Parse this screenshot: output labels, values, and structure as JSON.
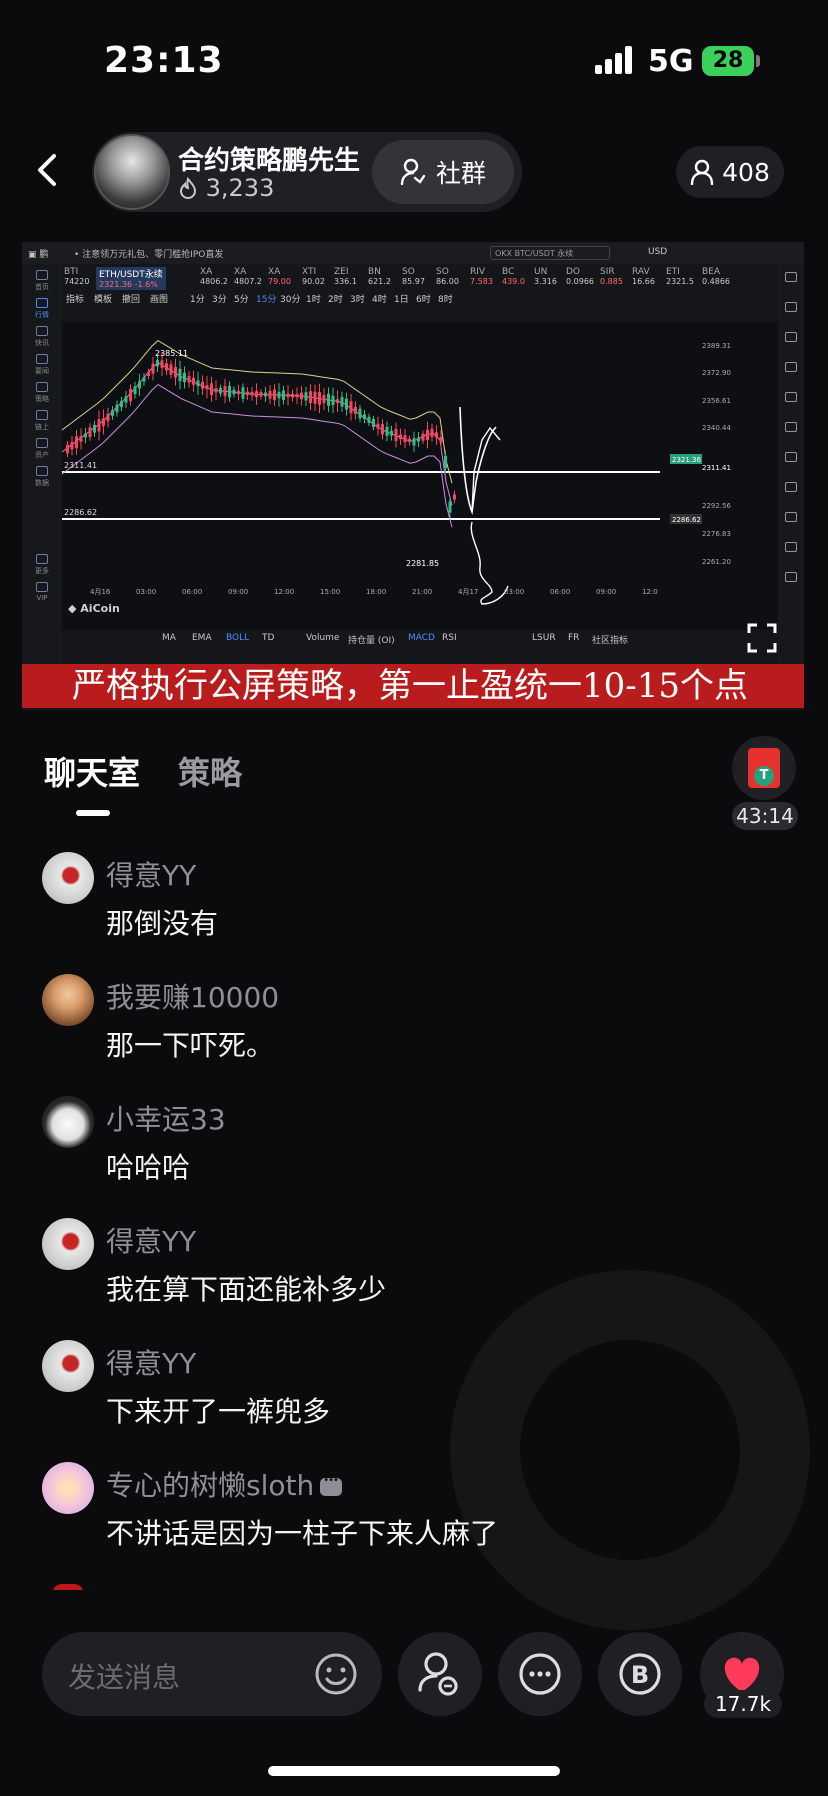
{
  "status": {
    "time": "23:13",
    "network": "5G",
    "battery": "28"
  },
  "header": {
    "streamer_name": "合约策略鹏先生",
    "heat": "3,233",
    "community_label": "社群",
    "viewer_count": "408"
  },
  "video": {
    "top_notice": "• 注意领万元礼包、零门槛抢IPO直发",
    "search_placeholder": "OKX BTC/USDT 永续",
    "currency": "USD",
    "tickers": [
      {
        "sym": "BTI",
        "val": "74220"
      },
      {
        "sym": "ETH/USDT永续",
        "val": "2321.36 -1.6%"
      },
      {
        "sym": "XA",
        "val": "4806.2"
      },
      {
        "sym": "XA",
        "val": "4807.2"
      },
      {
        "sym": "XA",
        "val": "79.00"
      },
      {
        "sym": "XTI",
        "val": "90.02"
      },
      {
        "sym": "ZEI",
        "val": "336.1"
      },
      {
        "sym": "BN",
        "val": "621.2"
      },
      {
        "sym": "SO",
        "val": "85.97"
      },
      {
        "sym": "SO",
        "val": "86.00"
      },
      {
        "sym": "RIV",
        "val": "7.583"
      },
      {
        "sym": "BC",
        "val": "439.0"
      },
      {
        "sym": "UN",
        "val": "3.316"
      },
      {
        "sym": "DO",
        "val": "0.0966"
      },
      {
        "sym": "SIR",
        "val": "0.885"
      },
      {
        "sym": "RAV",
        "val": "16.66"
      },
      {
        "sym": "ETI",
        "val": "2321.5"
      },
      {
        "sym": "BEA",
        "val": "0.4866"
      }
    ],
    "toolbar_left": [
      "指标",
      "模板",
      "撤回",
      "画图"
    ],
    "intervals": [
      "1分",
      "3分",
      "5分",
      "15分",
      "30分",
      "1时",
      "2时",
      "3时",
      "4时",
      "1日",
      "6时",
      "8时"
    ],
    "price_labels": [
      "2389.31",
      "2372.90",
      "2356.61",
      "2340.44",
      "2321.36",
      "2311.41",
      "2292.56",
      "2286.62",
      "2276.83",
      "2261.20"
    ],
    "left_price_labels": [
      "2311.41",
      "2286.62"
    ],
    "high_label": "2385.11",
    "low_label": "2281.85",
    "time_labels": [
      "4月16",
      "03:00",
      "06:00",
      "09:00",
      "12:00",
      "15:00",
      "18:00",
      "21:00",
      "4月17",
      "03:00",
      "06:00",
      "09:00",
      "12:0"
    ],
    "indicators": [
      "MA",
      "EMA",
      "BOLL",
      "TD",
      "Volume",
      "持仓量 (OI)",
      "MACD",
      "RSI",
      "LSUR",
      "FR",
      "社区指标"
    ],
    "aicoin_label": "AiCoin",
    "caption": "严格执行公屏策略，第一止盈统一10-15个点",
    "side_labels": [
      "首页",
      "行情",
      "快讯",
      "要闻",
      "策略",
      "链上",
      "资产",
      "数据",
      "更多",
      "VIP"
    ]
  },
  "tabs": {
    "chat": "聊天室",
    "strategy": "策略"
  },
  "gift": {
    "time": "43:14"
  },
  "messages": [
    {
      "nick": "得意YY",
      "text": "那倒没有",
      "avatar": "deyi"
    },
    {
      "nick": "我要赚10000",
      "text": "那一下吓死。",
      "avatar": "zhuan"
    },
    {
      "nick": "小幸运33",
      "text": "哈哈哈",
      "avatar": "xiao"
    },
    {
      "nick": "得意YY",
      "text": "我在算下面还能补多少",
      "avatar": "deyi"
    },
    {
      "nick": "得意YY",
      "text": "下来开了一裤兜多",
      "avatar": "deyi"
    },
    {
      "nick": "专心的树懒sloth",
      "text": "不讲话是因为一柱子下来人麻了",
      "avatar": "sloth"
    }
  ],
  "bottom": {
    "input_placeholder": "发送消息",
    "likes": "17.7k"
  },
  "colors": {
    "accent_red": "#b81c1c",
    "like_red": "#ff3b5c",
    "battery_green": "#3ad15a",
    "bg": "#0b0b0d"
  }
}
